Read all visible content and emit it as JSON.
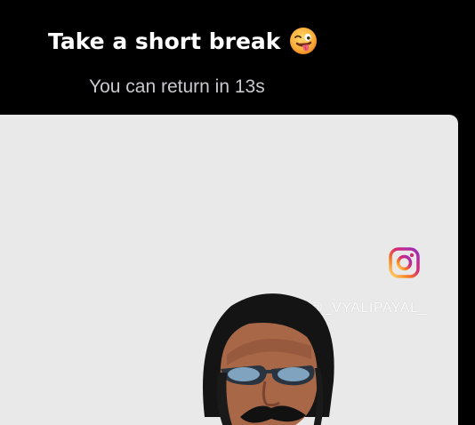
{
  "break_screen": {
    "title": "Take a short break",
    "title_emoji": "zany-face-emoji",
    "countdown_text": "You can return in 13s"
  },
  "video": {
    "watermark_icon": "instagram-icon",
    "watermark_handle": "@_VYALIPAYAL_"
  },
  "colors": {
    "background": "#000000",
    "card_background": "#e9e9e9",
    "title_color": "#ffffff",
    "subtitle_color": "#c9c9ce",
    "instagram_gradient_start": "#feda75",
    "instagram_gradient_mid": "#d62976",
    "instagram_gradient_end": "#962fbf"
  }
}
